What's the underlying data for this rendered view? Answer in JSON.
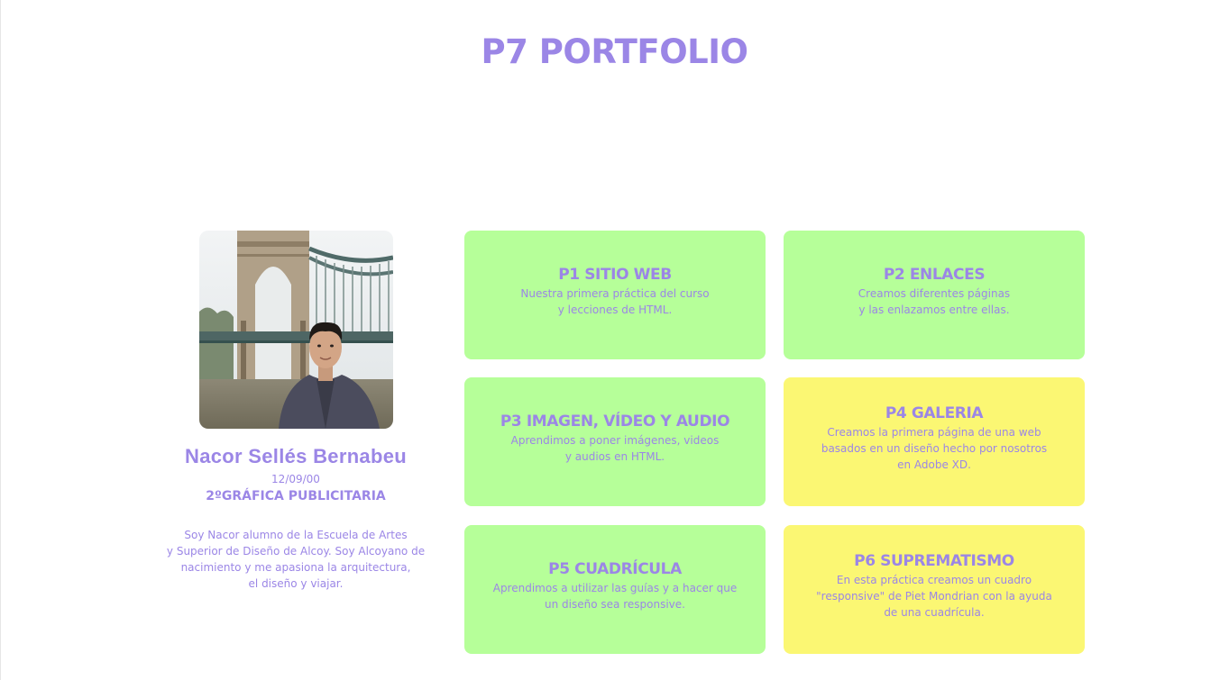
{
  "page": {
    "title": "P7 PORTFOLIO"
  },
  "profile": {
    "photo_icon": "profile-photo",
    "name": "Nacor Sellés Bernabeu",
    "date": "12/09/00",
    "course": "2ºGRÁFICA PUBLICITARIA",
    "bio_lines": [
      "Soy Nacor alumno de la Escuela de Artes",
      "y Superior de Diseño de Alcoy. Soy Alcoyano de",
      "nacimiento y me apasiona la arquitectura,",
      "el diseño y viajar."
    ]
  },
  "projects": [
    {
      "title": "P1 SITIO WEB",
      "desc": [
        "Nuestra primera práctica del curso",
        "y lecciones de HTML."
      ],
      "color": "#b6ff99"
    },
    {
      "title": "P2 ENLACES",
      "desc": [
        "Creamos diferentes páginas",
        "y las enlazamos entre ellas."
      ],
      "color": "#b6ff99"
    },
    {
      "title": "P3 IMAGEN, VÍDEO Y AUDIO",
      "desc": [
        "Aprendimos a poner imágenes, videos",
        "y audios en HTML."
      ],
      "color": "#b6ff99"
    },
    {
      "title": "P4 GALERIA",
      "desc": [
        "Creamos la primera página de una web",
        "basados en un diseño hecho por nosotros",
        "en Adobe XD."
      ],
      "color": "#fbf773"
    },
    {
      "title": "P5 CUADRÍCULA",
      "desc": [
        "Aprendimos a utilizar las guías y a hacer que",
        "un diseño sea responsive."
      ],
      "color": "#b6ff99"
    },
    {
      "title": "P6 SUPREMATISMO",
      "desc": [
        "En esta práctica creamos un cuadro",
        "\"responsive\" de Piet Mondrian con la ayuda",
        "de una cuadrícula."
      ],
      "color": "#fbf773"
    }
  ],
  "colors": {
    "accent": "#9b86e6",
    "green_card": "#b6ff99",
    "yellow_card": "#fbf773",
    "background": "#ffffff"
  }
}
